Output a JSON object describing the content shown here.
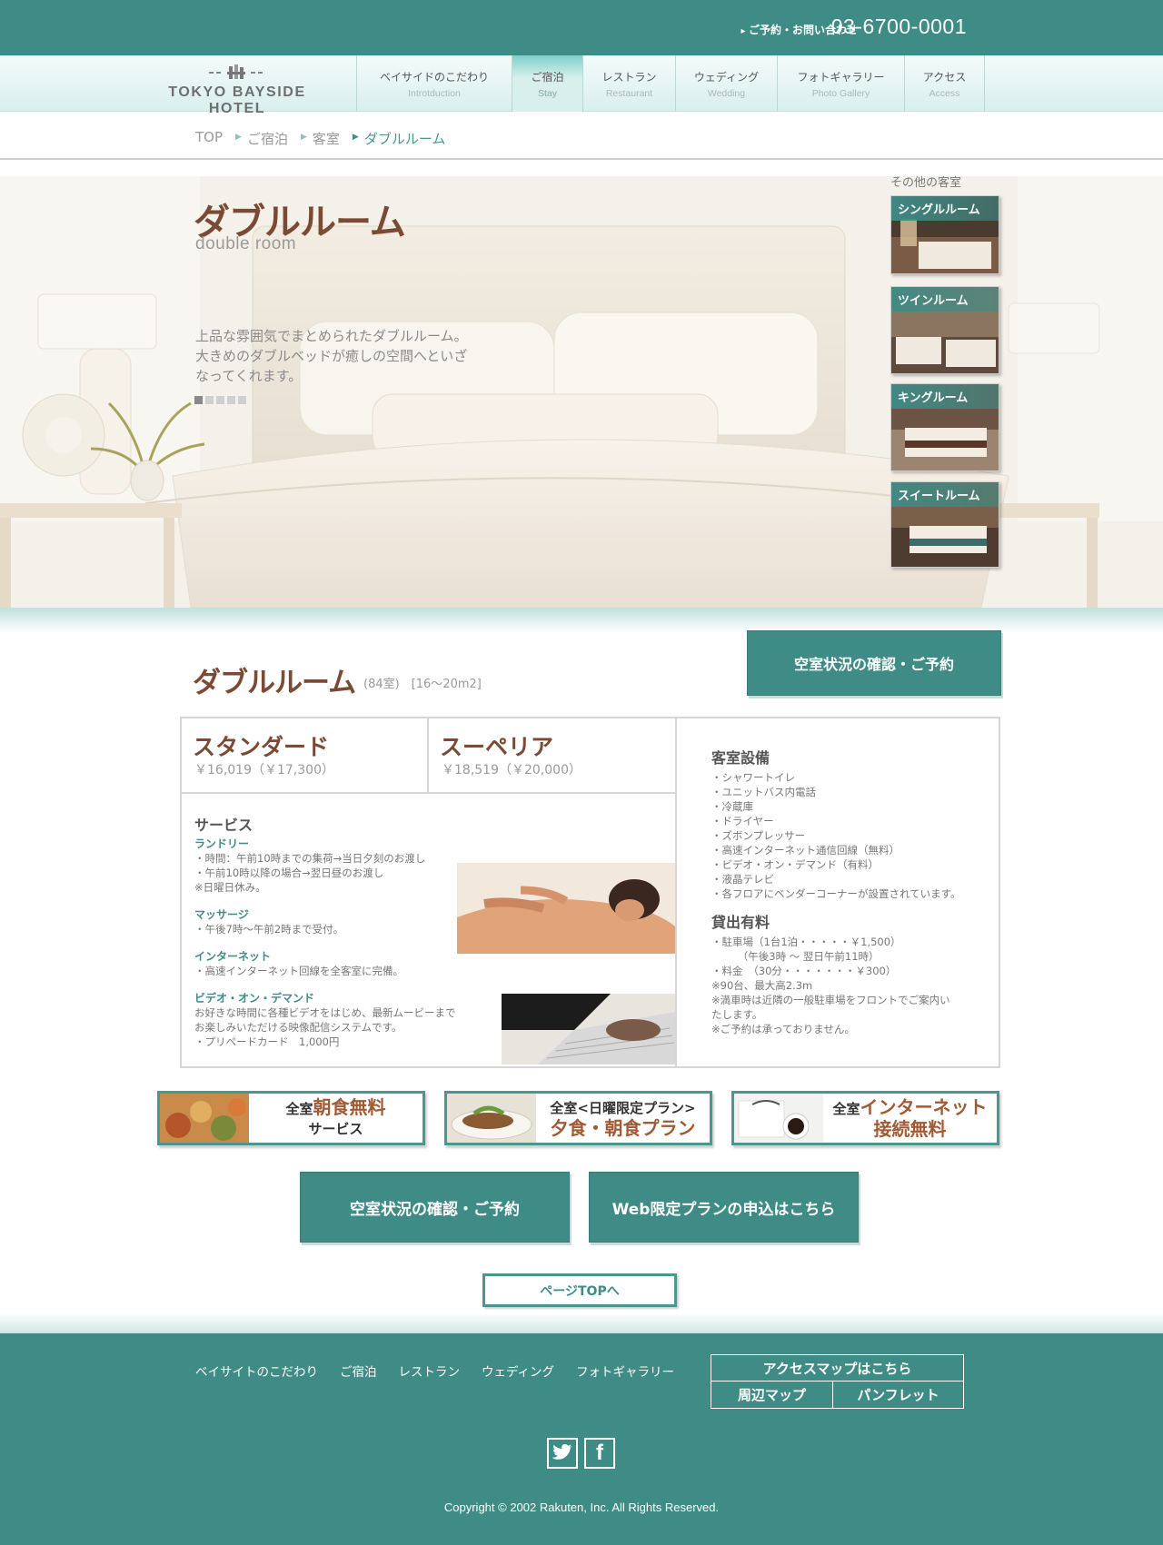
{
  "header": {
    "contact_label": "ご予約・お問い合わせ",
    "phone": "03-6700-0001",
    "logo_text": "TOKYO BAYSIDE HOTEL"
  },
  "nav": {
    "items": [
      {
        "ja": "ベイサイドのこだわり",
        "en": "Introtduction"
      },
      {
        "ja": "ご宿泊",
        "en": "Stay"
      },
      {
        "ja": "レストラン",
        "en": "Restaurant"
      },
      {
        "ja": "ウェディング",
        "en": "Wedding"
      },
      {
        "ja": "フォトギャラリー",
        "en": "Photo Gallery"
      },
      {
        "ja": "アクセス",
        "en": "Access"
      }
    ],
    "active": "Stay"
  },
  "breadcrumb": [
    "TOP",
    "ご宿泊",
    "客室",
    "ダブルルーム"
  ],
  "hero": {
    "title": "ダブルルーム",
    "subtitle": "double room",
    "description_lines": [
      "上品な雰囲気でまとめられたダブルルーム。",
      "大きめのダブルベッドが癒しの空間へといざ",
      "なってくれます。"
    ],
    "slide_count": 5,
    "active_slide": 1,
    "other_rooms_label": "その他の客室",
    "other_rooms": [
      "シングルルーム",
      "ツインルーム",
      "キングルーム",
      "スイートルーム"
    ]
  },
  "room": {
    "title": "ダブルルーム",
    "meta": "(84室)　[16〜20m2]",
    "reserve_button": "空室状況の確認・ご予約",
    "plans": [
      {
        "name": "スタンダード",
        "price": "￥16,019（￥17,300）"
      },
      {
        "name": "スーペリア",
        "price": "￥18,519（￥20,000）"
      }
    ],
    "services": {
      "heading": "サービス",
      "blocks": [
        {
          "title": "ランドリー",
          "lines": [
            "・時間：午前10時までの集荷→当日夕刻のお渡し",
            "・午前10時以降の場合→翌日昼のお渡し",
            "※日曜日休み。"
          ]
        },
        {
          "title": "マッサージ",
          "lines": [
            "・午後7時〜午前2時まで受付。"
          ]
        },
        {
          "title": "インターネット",
          "lines": [
            "・高速インターネット回線を全客室に完備。"
          ]
        },
        {
          "title": "ビデオ・オン・デマンド",
          "lines": [
            "お好きな時間に各種ビデオをはじめ、最新ムービーまで",
            "お楽しみいただける映像配信システムです。",
            "・プリペードカード　1,000円"
          ]
        }
      ]
    },
    "amenities": {
      "heading": "客室設備",
      "lines": [
        "・シャワートイレ",
        "・ユニットバス内電話",
        "・冷蔵庫",
        "・ドライヤー",
        "・ズボンプレッサー",
        "・高速インターネット通信回線（無料）",
        "・ビデオ・オン・デマンド（有料）",
        "・液晶テレビ",
        "・各フロアにベンダーコーナーが設置されています。"
      ]
    },
    "rental": {
      "heading": "貸出有料",
      "lines": [
        "・駐車場（1台1泊・・・・・￥1,500）",
        "　　　（午後3時 〜 翌日午前11時）",
        "・料金　（30分・・・・・・・￥300）",
        "※90台、最大高2.3m",
        "※満車時は近隣の一般駐車場をフロントでご案内い",
        "たします。",
        "※ご予約は承っておりません。"
      ]
    }
  },
  "banners": [
    {
      "small": "全室",
      "big": "朝食無料",
      "line2": "サービス"
    },
    {
      "small": "全室<日曜限定プラン>",
      "big": "夕食・朝食プラン",
      "line2": ""
    },
    {
      "small": "全室",
      "big": "インターネット",
      "line2": "接続無料"
    }
  ],
  "actions": {
    "reserve": "空室状況の確認・ご予約",
    "web_plan": "Web限定プランの申込はこちら",
    "page_top": "ページTOPへ"
  },
  "footer": {
    "links": [
      "ベイサイトのこだわり",
      "ご宿泊",
      "レストラン",
      "ウェディング",
      "フォトギャラリー"
    ],
    "access_map": "アクセスマップはこちら",
    "area_map": "周辺マップ",
    "pamphlet": "パンフレット",
    "copyright": "Copyright © 2002 Rakuten, Inc. All Rights Reserved."
  },
  "colors": {
    "accent": "#3f8b86",
    "brown": "#7a4a35"
  }
}
